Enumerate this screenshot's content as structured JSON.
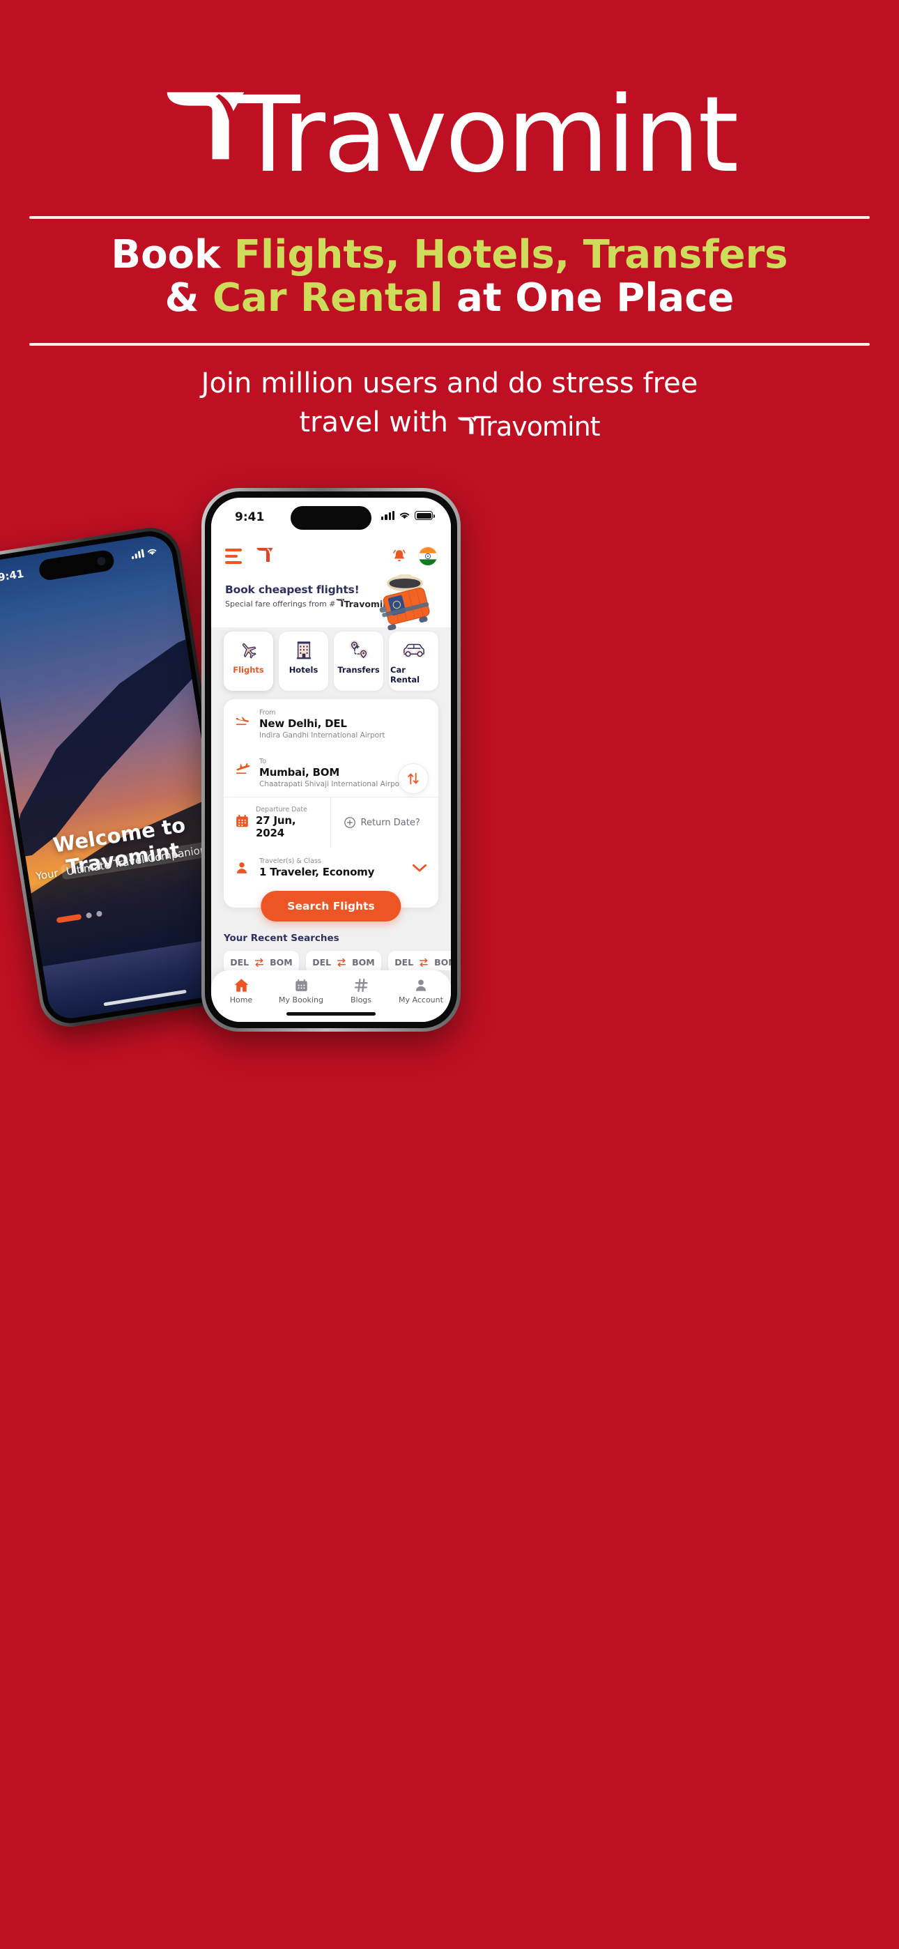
{
  "brand": {
    "name": "Travomint",
    "red": "#BE1022",
    "accent_yellow": "#CEDC5C",
    "orange": "#EE5524",
    "navy": "#2E3060"
  },
  "hero": {
    "logo_text": "Travomint",
    "logo_icon": "travomint-bird-logo",
    "headline_line1_pre": "Book ",
    "headline_flights": "Flights,",
    "headline_hotels": " Hotels,",
    "headline_transfers": " Transfers",
    "headline_line2_amp": "& ",
    "headline_car_rental": "Car Rental",
    "headline_line2_post": " at One Place",
    "subheading_pre": "Join million users and do stress free",
    "subheading_post": "travel with ",
    "subheading_brand": "Travomint"
  },
  "phone_left": {
    "status_time": "9:41",
    "welcome_title": "Welcome to Travomint",
    "welcome_tagline_pre": "Your ",
    "welcome_tagline_hl": "Ultimate Travel Companion",
    "signal_icon": "cellular-signal-icon",
    "wifi_icon": "wifi-icon"
  },
  "phone_right": {
    "status_time": "9:41",
    "status_icons": [
      "cellular-signal-icon",
      "wifi-icon",
      "battery-icon"
    ],
    "header": {
      "menu_icon": "hamburger-menu-icon",
      "logo_icon": "travomint-bird-logo",
      "bell_icon": "notification-bell-icon",
      "flag_icon": "india-flag-icon"
    },
    "promo": {
      "title": "Book cheapest flights!",
      "subtitle_pre": "Special fare offerings from #",
      "subtitle_brand": "Travomint",
      "image": "suitcase-hat-passport-illustration"
    },
    "tabs": [
      {
        "label": "Flights",
        "icon": "airplane-icon",
        "active": true
      },
      {
        "label": "Hotels",
        "icon": "building-icon",
        "active": false
      },
      {
        "label": "Transfers",
        "icon": "route-pins-icon",
        "active": false
      },
      {
        "label": "Car Rental",
        "icon": "car-icon",
        "active": false
      }
    ],
    "search_form": {
      "from_label": "From",
      "from_value": "New Delhi, DEL",
      "from_airport": "Indira Gandhi International Airport",
      "from_icon": "flight-takeoff-icon",
      "to_label": "To",
      "to_value": "Mumbai, BOM",
      "to_airport": "Chaatrapati Shivaji International Airport",
      "to_icon": "flight-land-icon",
      "swap_icon": "swap-vertical-icon",
      "departure_label": "Departure Date",
      "departure_value": "27 Jun, 2024",
      "departure_icon": "calendar-icon",
      "return_label": "Return Date?",
      "return_icon": "plus-circle-icon",
      "traveler_label": "Traveler(s) & Class",
      "traveler_value": "1 Traveler, Economy",
      "traveler_icon": "person-icon",
      "traveler_chevron": "chevron-down-icon",
      "search_button": "Search Flights"
    },
    "recent": {
      "heading": "Your Recent Searches",
      "items": [
        {
          "origin": "DEL",
          "destination": "BOM",
          "icon": "swap-horizontal-icon"
        },
        {
          "origin": "DEL",
          "destination": "BOM",
          "icon": "swap-horizontal-icon"
        },
        {
          "origin": "DEL",
          "destination": "BOM",
          "icon": "swap-horizontal-icon"
        }
      ]
    },
    "bottom_nav": [
      {
        "label": "Home",
        "icon": "home-icon",
        "active": true
      },
      {
        "label": "My Booking",
        "icon": "calendar-icon",
        "active": false
      },
      {
        "label": "Blogs",
        "icon": "hash-icon",
        "active": false
      },
      {
        "label": "My Account",
        "icon": "person-icon",
        "active": false
      }
    ]
  }
}
